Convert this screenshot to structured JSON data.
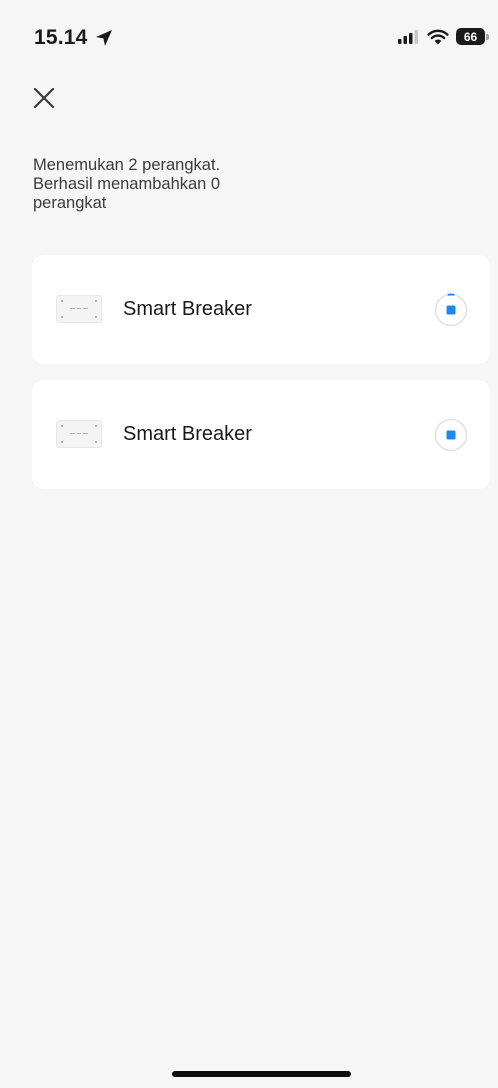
{
  "status_bar": {
    "time": "15.14",
    "battery_level": "66",
    "location_icon": "location-arrow-icon",
    "signal_icon": "cellular-signal-icon",
    "wifi_icon": "wifi-icon"
  },
  "header": {
    "close_icon": "close-icon"
  },
  "message": {
    "line1": "Menemukan 2 perangkat.",
    "line2": "Berhasil menambahkan 0",
    "line3": "perangkat"
  },
  "devices": [
    {
      "name": "Smart Breaker",
      "status": "adding",
      "action_icon": "stop-progress-icon"
    },
    {
      "name": "Smart Breaker",
      "status": "adding",
      "action_icon": "stop-progress-icon"
    }
  ],
  "colors": {
    "background": "#f6f6f6",
    "card": "#ffffff",
    "accent": "#1e88f0",
    "text": "#1a1a1a"
  }
}
